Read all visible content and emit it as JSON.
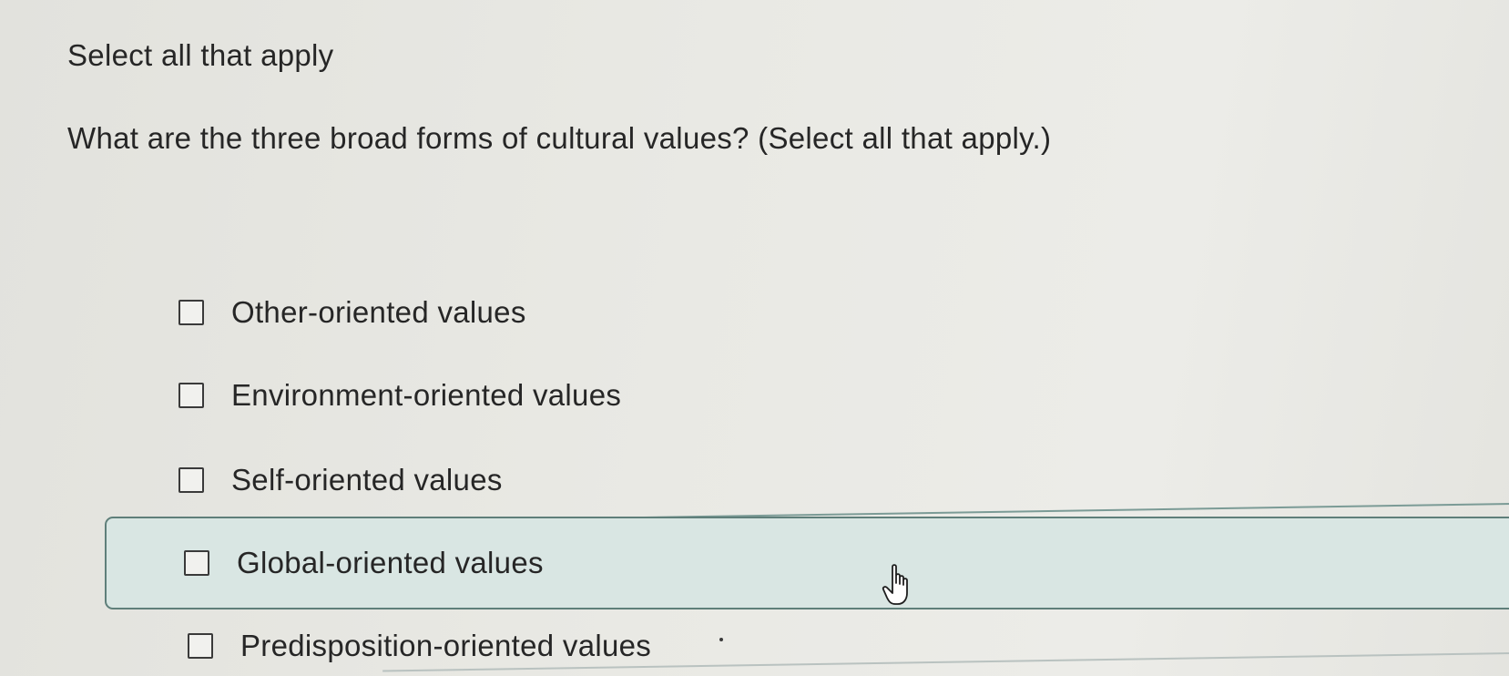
{
  "instruction": "Select all that apply",
  "question": "What are the three broad forms of cultural values? (Select all that apply.)",
  "options": [
    {
      "label": "Other-oriented values",
      "checked": false
    },
    {
      "label": "Environment-oriented values",
      "checked": false
    },
    {
      "label": "Self-oriented values",
      "checked": false
    },
    {
      "label": "Global-oriented values",
      "checked": false,
      "hovered": true
    },
    {
      "label": "Predisposition-oriented values",
      "checked": false
    }
  ],
  "icons": {
    "cursor": "hand-pointer-icon",
    "checkbox": "checkbox-unchecked-icon"
  },
  "colors": {
    "hover_background": "#d9e6e3",
    "hover_border": "#5f7f7a",
    "text": "#262626"
  }
}
